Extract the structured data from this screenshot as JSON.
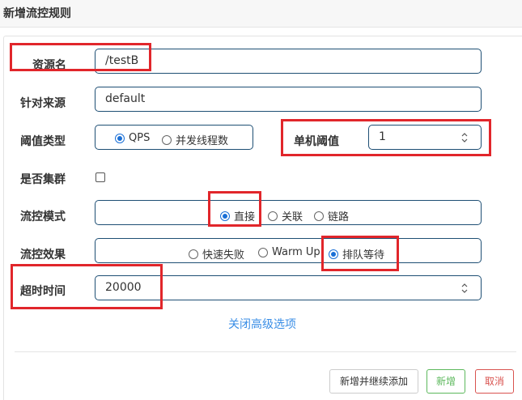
{
  "dialog": {
    "title": "新增流控规则"
  },
  "form": {
    "resource": {
      "label": "资源名",
      "value": "/testB"
    },
    "limit_app": {
      "label": "针对来源",
      "value": "default"
    },
    "threshold_type": {
      "label": "阈值类型",
      "options": [
        "QPS",
        "并发线程数"
      ],
      "selected": "QPS"
    },
    "threshold": {
      "label": "单机阈值",
      "value": "1"
    },
    "cluster": {
      "label": "是否集群",
      "checked": false
    },
    "flow_mode": {
      "label": "流控模式",
      "options": [
        "直接",
        "关联",
        "链路"
      ],
      "selected": "直接"
    },
    "flow_effect": {
      "label": "流控效果",
      "options": [
        "快速失败",
        "Warm Up",
        "排队等待"
      ],
      "selected": "排队等待"
    },
    "timeout": {
      "label": "超时时间",
      "value": "20000"
    }
  },
  "advanced_toggle": "关闭高级选项",
  "footer": {
    "add_continue_label": "新增并继续添加",
    "add_label": "新增",
    "cancel_label": "取消"
  },
  "colors": {
    "primary": "#1a6fd6",
    "field_border": "#1e4f74",
    "annotation": "#e1262b",
    "success": "#5cb85c",
    "danger": "#d9534f",
    "link": "#3a8ee6"
  }
}
